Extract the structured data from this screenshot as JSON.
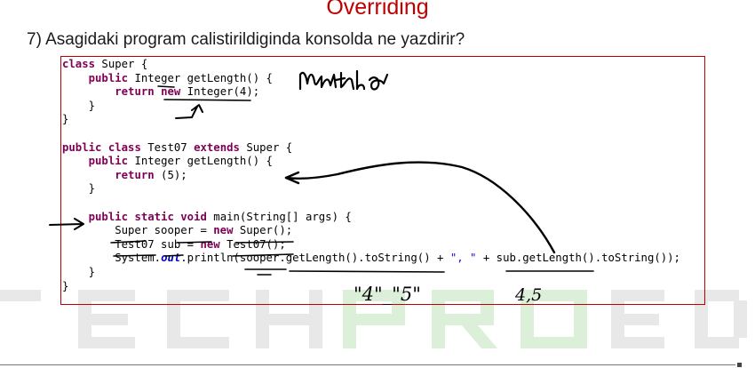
{
  "slide": {
    "title": "Overriding",
    "question": "7) Asagidaki program calistirildiginda konsolda ne yazdirir?"
  },
  "watermark": {
    "letters": [
      "T",
      "E",
      "C",
      "H",
      "P",
      "R",
      "O",
      "E",
      "D"
    ]
  },
  "code": {
    "lines": [
      [
        {
          "t": "class",
          "k": "kw"
        },
        {
          "t": " Super {"
        }
      ],
      [
        {
          "t": "    "
        },
        {
          "t": "public",
          "k": "kw"
        },
        {
          "t": " Integer getLength() {"
        }
      ],
      [
        {
          "t": "        "
        },
        {
          "t": "return",
          "k": "kw"
        },
        {
          "t": " "
        },
        {
          "t": "new",
          "k": "kw"
        },
        {
          "t": " Integer(4);"
        }
      ],
      [
        {
          "t": "    }"
        }
      ],
      [
        {
          "t": "}"
        }
      ],
      [
        {
          "t": ""
        }
      ],
      [
        {
          "t": "public",
          "k": "kw"
        },
        {
          "t": " "
        },
        {
          "t": "class",
          "k": "kw"
        },
        {
          "t": " Test07 "
        },
        {
          "t": "extends",
          "k": "kw"
        },
        {
          "t": " Super {"
        }
      ],
      [
        {
          "t": "    "
        },
        {
          "t": "public",
          "k": "kw"
        },
        {
          "t": " Integer getLength() {"
        }
      ],
      [
        {
          "t": "        "
        },
        {
          "t": "return",
          "k": "kw"
        },
        {
          "t": " (5);"
        }
      ],
      [
        {
          "t": "    }"
        }
      ],
      [
        {
          "t": ""
        }
      ],
      [
        {
          "t": "    "
        },
        {
          "t": "public",
          "k": "kw"
        },
        {
          "t": " "
        },
        {
          "t": "static",
          "k": "kw"
        },
        {
          "t": " "
        },
        {
          "t": "void",
          "k": "kw"
        },
        {
          "t": " main(String[] args) {"
        }
      ],
      [
        {
          "t": "        Super sooper = "
        },
        {
          "t": "new",
          "k": "kw"
        },
        {
          "t": " Super();"
        }
      ],
      [
        {
          "t": "        Test07 sub = "
        },
        {
          "t": "new",
          "k": "kw"
        },
        {
          "t": " Test07();"
        }
      ],
      [
        {
          "t": "        System."
        },
        {
          "t": "out",
          "k": "fld"
        },
        {
          "t": ".println(sooper.getLength().toString() + "
        },
        {
          "t": "\", \"",
          "k": "str"
        },
        {
          "t": " + sub.getLength().toString());"
        }
      ],
      [
        {
          "t": "    }"
        }
      ],
      [
        {
          "t": "}"
        }
      ]
    ]
  },
  "handwriting": {
    "word": "method",
    "answer_left": "\"4\"_\"5\"",
    "answer_right": "4,5"
  },
  "colors": {
    "title": "#c00000",
    "box_border": "#c00000",
    "keyword": "#7f0055",
    "string": "#2a00ff",
    "field": "#0000c0",
    "watermark_gray": "#e6e6e6",
    "watermark_green": "#dcefd9"
  }
}
